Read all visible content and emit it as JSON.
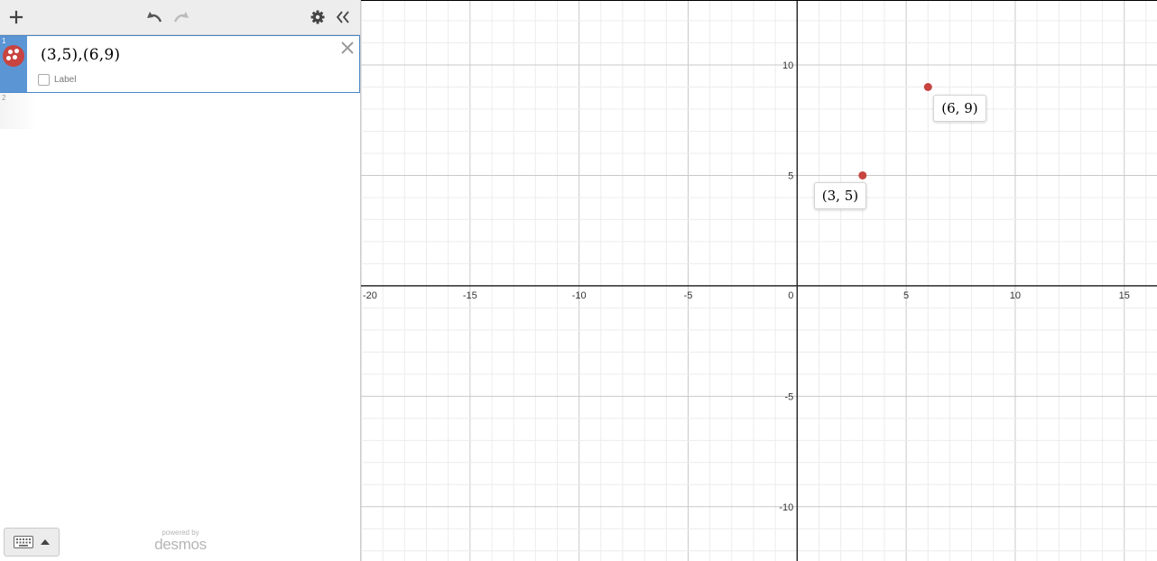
{
  "toolbar": {
    "add_icon": "plus-icon",
    "undo_icon": "undo-icon",
    "redo_icon": "redo-icon",
    "settings_icon": "gear-icon",
    "collapse_icon": "double-chevron-left-icon"
  },
  "expressions": [
    {
      "index": "1",
      "latex": "(3,5),(6,9)",
      "label_option": "Label",
      "color": "#c74440",
      "active": true
    },
    {
      "index": "2",
      "latex": "",
      "active": false
    }
  ],
  "footer": {
    "keyboard_icon": "keyboard-icon",
    "powered_by": "powered by",
    "brand": "desmos"
  },
  "chart_data": {
    "type": "scatter",
    "series": [
      {
        "color": "#c74440",
        "points": [
          {
            "x": 3,
            "y": 5,
            "label": "(3, 5)"
          },
          {
            "x": 6,
            "y": 9,
            "label": "(6, 9)"
          }
        ]
      }
    ],
    "xlim": [
      -20,
      16.5
    ],
    "ylim": [
      -12.5,
      12.9
    ],
    "x_ticks": [
      -20,
      -15,
      -10,
      -5,
      0,
      5,
      10,
      15
    ],
    "y_ticks": [
      -10,
      -5,
      5,
      10
    ],
    "x_tick_labels": [
      "-20",
      "-15",
      "-10",
      "-5",
      "0",
      "5",
      "10",
      "15"
    ],
    "y_tick_labels": [
      "-10",
      "-5",
      "5",
      "10"
    ],
    "major_grid_step": 5,
    "minor_grid_step": 1,
    "grid": true
  }
}
